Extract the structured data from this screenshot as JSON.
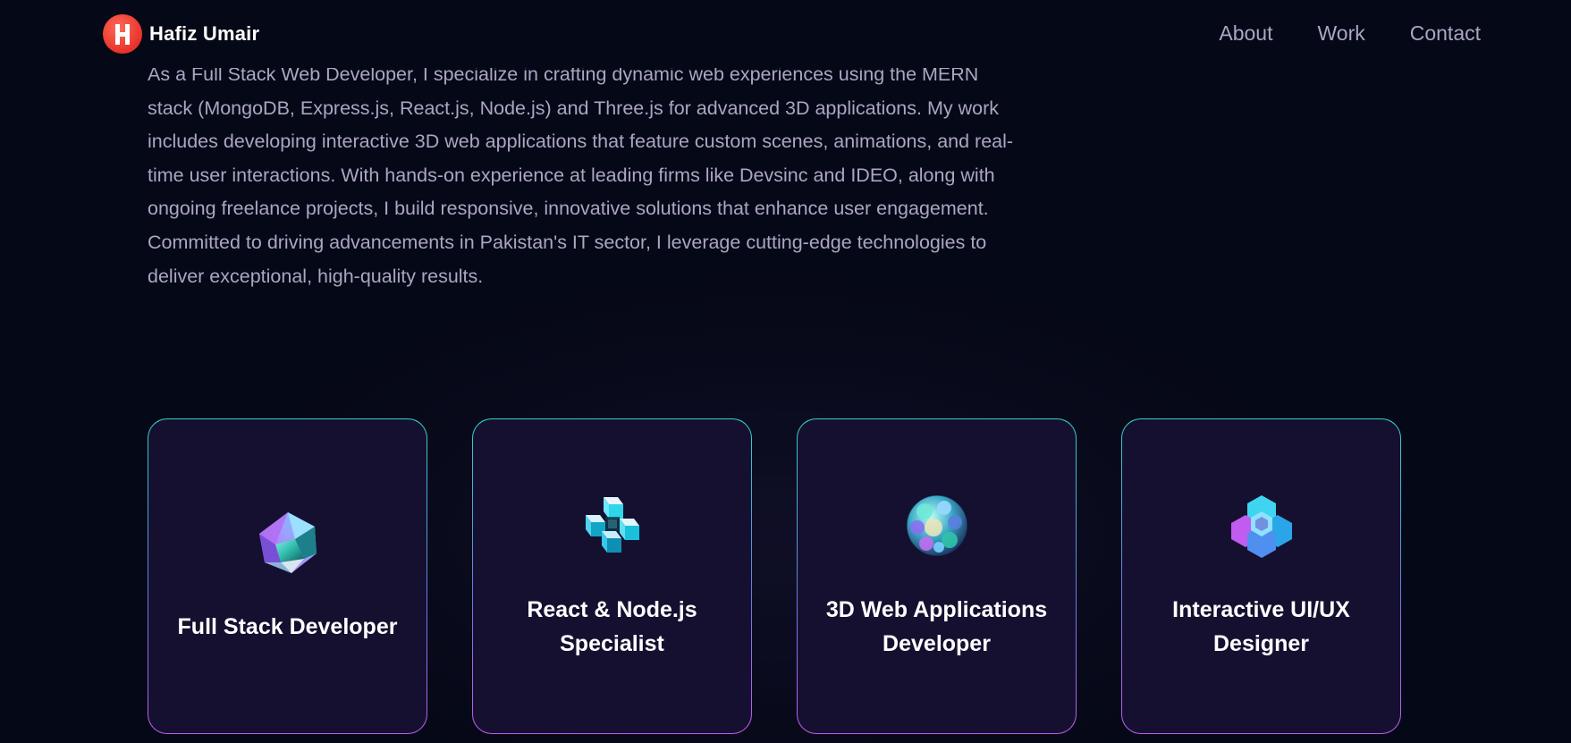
{
  "navbar": {
    "brand_name": "Hafiz Umair",
    "logo_letter": "H",
    "links": [
      {
        "label": "About"
      },
      {
        "label": "Work"
      },
      {
        "label": "Contact"
      }
    ]
  },
  "overview": {
    "text": "As a Full Stack Web Developer, I specialize in crafting dynamic web experiences using the MERN stack (MongoDB, Express.js, React.js, Node.js) and Three.js for advanced 3D applications. My work includes developing interactive 3D web applications that feature custom scenes, animations, and real-time user interactions. With hands-on experience at leading firms like Devsinc and IDEO, along with ongoing freelance projects, I build responsive, innovative solutions that enhance user engagement. Committed to driving advancements in Pakistan's IT sector, I leverage cutting-edge technologies to deliver exceptional, high-quality results."
  },
  "services": [
    {
      "title": "Full Stack Developer",
      "icon": "geometric-gem-icon"
    },
    {
      "title": "React & Node.js Specialist",
      "icon": "cube-cluster-icon"
    },
    {
      "title": "3D Web Applications Developer",
      "icon": "sphere-cluster-icon"
    },
    {
      "title": "Interactive UI/UX Designer",
      "icon": "hex-cluster-icon"
    }
  ],
  "colors": {
    "background": "#050816",
    "card": "#151030",
    "secondary_text": "#aaa6c3",
    "logo_red": "#e8322a",
    "border_top": "#2fd6c4",
    "border_bottom": "#c15cf0"
  }
}
